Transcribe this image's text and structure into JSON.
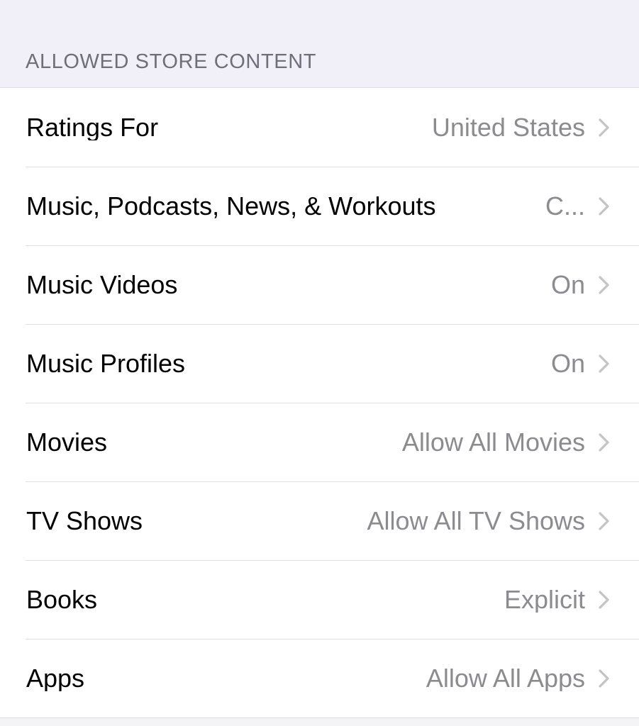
{
  "section": {
    "header": "ALLOWED STORE CONTENT"
  },
  "rows": [
    {
      "label": "Ratings For",
      "value": "United States",
      "accessory": "chevron-right-icon"
    },
    {
      "label": "Music, Podcasts, News, & Workouts",
      "value": "C...",
      "accessory": "chevron-right-icon"
    },
    {
      "label": "Music Videos",
      "value": "On",
      "accessory": "chevron-right-icon"
    },
    {
      "label": "Music Profiles",
      "value": "On",
      "accessory": "chevron-right-icon"
    },
    {
      "label": "Movies",
      "value": "Allow All Movies",
      "accessory": "chevron-right-icon"
    },
    {
      "label": "TV Shows",
      "value": "Allow All TV Shows",
      "accessory": "chevron-right-icon"
    },
    {
      "label": "Books",
      "value": "Explicit",
      "accessory": "chevron-right-icon"
    },
    {
      "label": "Apps",
      "value": "Allow All Apps",
      "accessory": "chevron-right-icon"
    }
  ],
  "colors": {
    "page_background": "#f1f0f9",
    "row_background": "#ffffff",
    "label_text": "#000000",
    "value_text": "#8b8b90",
    "header_text": "#6f6f78",
    "separator": "#e0e0e3",
    "chevron": "#c4c4c8"
  }
}
